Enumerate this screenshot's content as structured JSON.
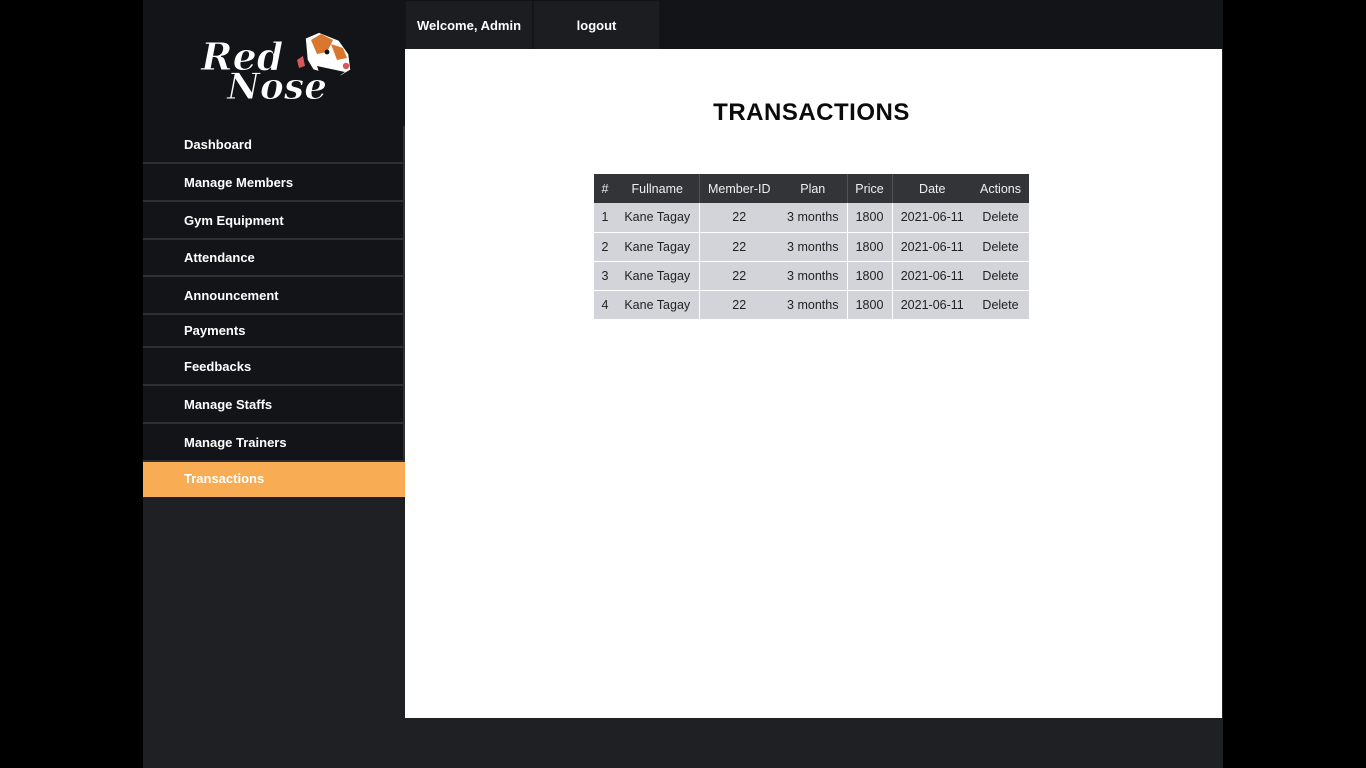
{
  "brand": {
    "logo_text": "RedNose"
  },
  "topbar": {
    "welcome_label": "Welcome, Admin",
    "logout_label": "logout"
  },
  "sidebar": {
    "items": [
      {
        "label": "Dashboard"
      },
      {
        "label": "Manage Members"
      },
      {
        "label": "Gym Equipment"
      },
      {
        "label": "Attendance"
      },
      {
        "label": "Announcement"
      },
      {
        "label": "Payments"
      },
      {
        "label": "Feedbacks"
      },
      {
        "label": "Manage Staffs"
      },
      {
        "label": "Manage  Trainers"
      },
      {
        "label": "Transactions"
      }
    ],
    "active_index": 9
  },
  "main": {
    "title": "TRANSACTIONS",
    "table": {
      "headers": [
        "#",
        "Fullname",
        "Member-ID",
        "Plan",
        "Price",
        "Date",
        "Actions"
      ],
      "rows": [
        {
          "num": "1",
          "fullname": "Kane Tagay",
          "member_id": "22",
          "plan": "3 months",
          "price": "1800",
          "date": "2021-06-11",
          "action": "Delete"
        },
        {
          "num": "2",
          "fullname": "Kane Tagay",
          "member_id": "22",
          "plan": "3 months",
          "price": "1800",
          "date": "2021-06-11",
          "action": "Delete"
        },
        {
          "num": "3",
          "fullname": "Kane Tagay",
          "member_id": "22",
          "plan": "3 months",
          "price": "1800",
          "date": "2021-06-11",
          "action": "Delete"
        },
        {
          "num": "4",
          "fullname": "Kane Tagay",
          "member_id": "22",
          "plan": "3 months",
          "price": "1800",
          "date": "2021-06-11",
          "action": "Delete"
        }
      ]
    }
  },
  "colors": {
    "accent": "#f8ac53",
    "sidebar_bg": "#131418",
    "delete": "#d5595b"
  }
}
